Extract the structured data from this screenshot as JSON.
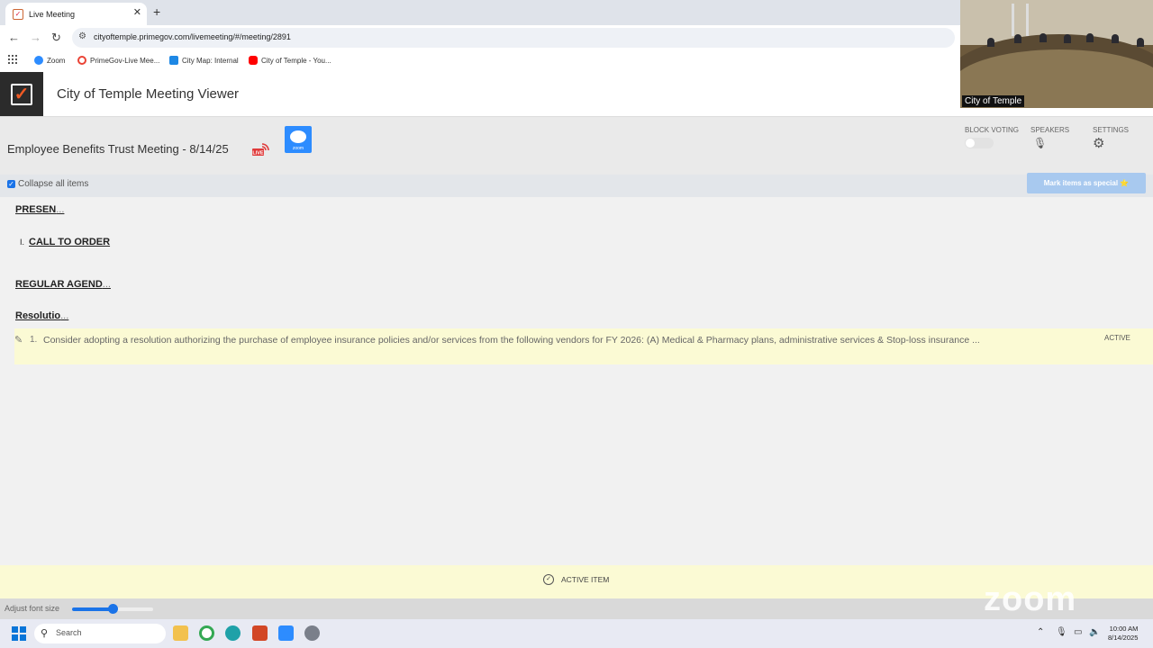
{
  "browser": {
    "tab_title": "Live Meeting",
    "url": "cityoftemple.primegov.com/livemeeting/#/meeting/2891",
    "bookmarks": [
      {
        "label": "Zoom",
        "color": "#2d8cff"
      },
      {
        "label": "PrimeGov-Live Mee...",
        "color": "#ea4335"
      },
      {
        "label": "City Map: Internal",
        "color": "#1e88e5"
      },
      {
        "label": "City of Temple - You...",
        "color": "#ff0000"
      }
    ]
  },
  "app": {
    "title": "City of Temple Meeting Viewer",
    "brand_color": "#ef5a24"
  },
  "meeting": {
    "title": "Employee Benefits Trust Meeting - 8/14/25",
    "live_label": "LIVE",
    "zoom_label": "zoom",
    "block_voting_label": "BLOCK VOTING",
    "speakers_label": "SPEAKERS",
    "settings_label": "SETTINGS"
  },
  "controls": {
    "collapse_label": "Collapse all items",
    "collapse_checked": true,
    "mark_special_label": "Mark items as special ⭐"
  },
  "agenda": {
    "sections": [
      {
        "label": "PRESEN",
        "ellipsis": "..."
      },
      {
        "label": "REGULAR AGEND",
        "ellipsis": "..."
      },
      {
        "label": "Resolutio",
        "ellipsis": "..."
      }
    ],
    "call_item": {
      "number": "I.",
      "label": "CALL TO ORDER"
    },
    "active_item": {
      "number": "1.",
      "text": "Consider adopting a resolution authorizing the purchase of employee insurance policies and/or services from the following vendors for FY 2026: (A) Medical & Pharmacy plans, administrative services & Stop-loss insurance ...",
      "status": "ACTIVE",
      "highlight_color": "#fbfad4"
    }
  },
  "footer": {
    "active_item_label": "ACTIVE ITEM",
    "font_size_label": "Adjust font size",
    "font_size_level": 0.5,
    "watermark": "zoom"
  },
  "video": {
    "caption": "City of Temple"
  },
  "taskbar": {
    "search_label": "Search",
    "time": "10:00 AM",
    "date": "8/14/2025"
  }
}
